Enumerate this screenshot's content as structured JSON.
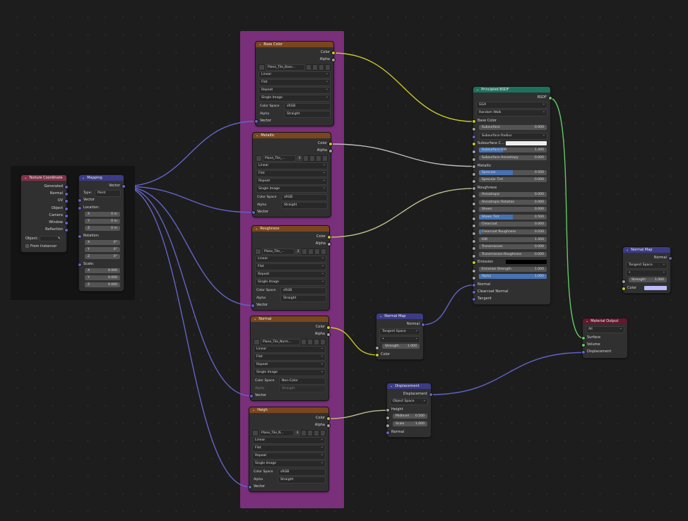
{
  "accent_colors": {
    "vector_socket": "#6363c7",
    "color_socket": "#c7c729",
    "float_socket": "#a1a1a1",
    "shader_socket": "#63c763",
    "frame": "#7a2f7a",
    "texture_header": "#79461d",
    "input_header": "#83314a",
    "vector_header": "#3b3b86",
    "shader_header": "#1d725e",
    "output_header": "#63182c"
  },
  "texcoord": {
    "title": "Texture Coordinate",
    "outputs": [
      "Generated",
      "Normal",
      "UV",
      "Object",
      "Camera",
      "Window",
      "Reflection"
    ],
    "object_label": "Object:",
    "from_instancer": "From Instancer"
  },
  "mapping": {
    "title": "Mapping",
    "out": "Vector",
    "type_label": "Type:",
    "type_value": "Point",
    "vector": "Vector",
    "location": "Location:",
    "rotation": "Rotation:",
    "scale": "Scale:",
    "loc": [
      {
        "a": "X",
        "v": "0 m"
      },
      {
        "a": "Y",
        "v": "0 m"
      },
      {
        "a": "Z",
        "v": "0 m"
      }
    ],
    "rot": [
      {
        "a": "X",
        "v": "0°"
      },
      {
        "a": "Y",
        "v": "0°"
      },
      {
        "a": "Z",
        "v": "0°"
      }
    ],
    "scl": [
      {
        "a": "X",
        "v": "9.000"
      },
      {
        "a": "Y",
        "v": "9.000"
      },
      {
        "a": "Z",
        "v": "9.000"
      }
    ]
  },
  "common": {
    "color": "Color",
    "alpha": "Alpha",
    "vector": "Vector",
    "linear": "Linear",
    "flat": "Flat",
    "repeat": "Repeat",
    "single_image": "Single Image",
    "color_space": "Color Space",
    "alpha_label": "Alpha",
    "straight": "Straight"
  },
  "textures": [
    {
      "title": "Base Color",
      "image": "Plane_Tile_Base...",
      "users": "",
      "colorspace": "sRGB"
    },
    {
      "title": "Metallic",
      "image": "Plane_Tile_...",
      "users": "3",
      "colorspace": "sRGB"
    },
    {
      "title": "Roughness",
      "image": "Plane_Tile_...",
      "users": "3",
      "colorspace": "sRGB"
    },
    {
      "title": "Normal",
      "image": "Plane_Tile_Norm...",
      "users": "",
      "colorspace": "Non-Color"
    },
    {
      "title": "Heigh",
      "image": "Plane_Tile_N...",
      "users": "3",
      "colorspace": "sRGB"
    }
  ],
  "bsdf": {
    "title": "Principled BSDF",
    "out": "BSDF",
    "dist": "GGX",
    "sss": "Random Walk",
    "base_color": "Base Color",
    "rows1": [
      {
        "n": "Subsurface",
        "v": "0.000",
        "f": 0
      }
    ],
    "sss_radius": "Subsurface Radius",
    "sss_color": "Subsurface C...",
    "rows2": [
      {
        "n": "Subsurface IOR",
        "v": "1.400",
        "f": 0.35
      },
      {
        "n": "Subsurface Anisotropy",
        "v": "0.000",
        "f": 0
      }
    ],
    "metallic": "Metallic",
    "rows3": [
      {
        "n": "Specular",
        "v": "0.500",
        "f": 0.5
      },
      {
        "n": "Specular Tint",
        "v": "0.000",
        "f": 0
      }
    ],
    "roughness": "Roughness",
    "rows4": [
      {
        "n": "Anisotropic",
        "v": "0.000",
        "f": 0
      },
      {
        "n": "Anisotropic Rotation",
        "v": "0.000",
        "f": 0
      },
      {
        "n": "Sheen",
        "v": "0.000",
        "f": 0
      },
      {
        "n": "Sheen Tint",
        "v": "0.500",
        "f": 0.5
      },
      {
        "n": "Clearcoat",
        "v": "0.000",
        "f": 0
      },
      {
        "n": "Clearcoat Roughness",
        "v": "0.030",
        "f": 0.03
      },
      {
        "n": "IOR",
        "v": "1.450",
        "f": 0
      },
      {
        "n": "Transmission",
        "v": "0.000",
        "f": 0
      },
      {
        "n": "Transmission Roughness",
        "v": "0.000",
        "f": 0
      }
    ],
    "emission": "Emission",
    "rows5": [
      {
        "n": "Emission Strength",
        "v": "1.000",
        "f": 0
      },
      {
        "n": "Alpha",
        "v": "1.000",
        "f": 1
      }
    ],
    "normal": "Normal",
    "clearcoat_normal": "Clearcoat Normal",
    "tangent": "Tangent"
  },
  "normalmap1": {
    "title": "Normal Map",
    "out": "Normal",
    "space": "Tangent Space",
    "strength_n": "Strength",
    "strength_v": "1.000",
    "color": "Color"
  },
  "normalmap2": {
    "title": "Normal Map",
    "out": "Normal",
    "space": "Tangent Space",
    "strength_n": "Strength",
    "strength_v": "1.000",
    "color": "Color"
  },
  "displacement": {
    "title": "Displacement",
    "out": "Displacement",
    "space": "Object Space",
    "height": "Height",
    "mid_n": "Midlevel",
    "mid_v": "0.500",
    "scale_n": "Scale",
    "scale_v": "1.000",
    "normal": "Normal"
  },
  "output": {
    "title": "Material Output",
    "target": "All",
    "surface": "Surface",
    "volume": "Volume",
    "displacement": "Displacement"
  }
}
